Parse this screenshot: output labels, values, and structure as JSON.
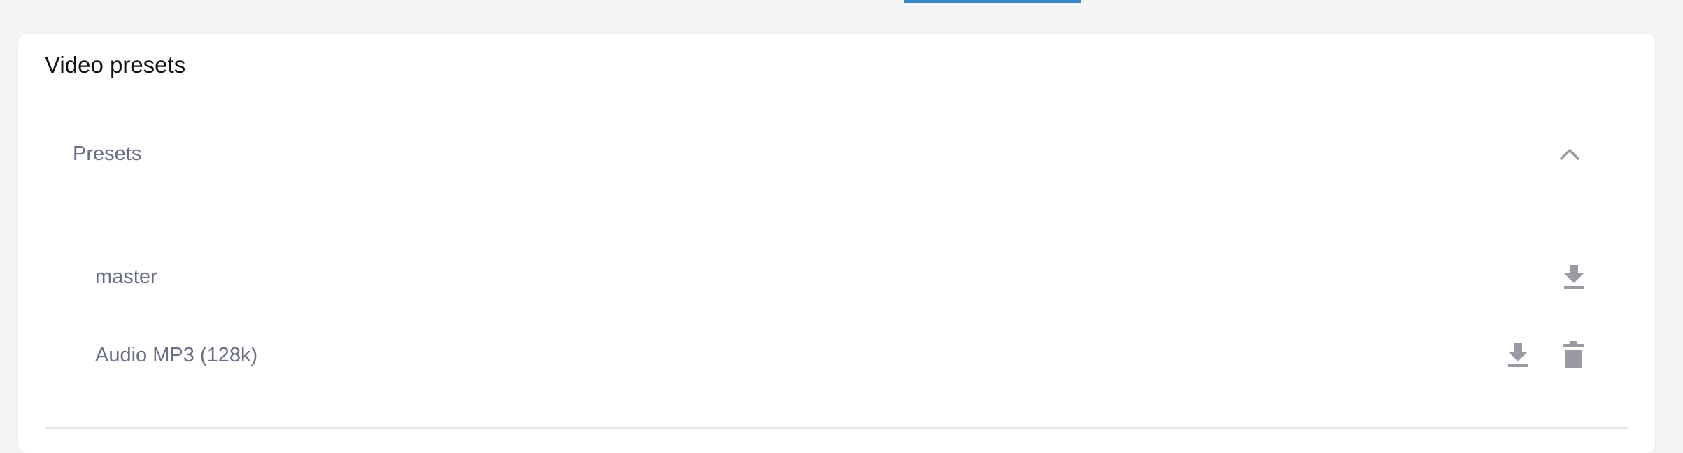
{
  "card": {
    "title": "Video presets"
  },
  "presets_section": {
    "title": "Presets",
    "expanded": true,
    "items": [
      {
        "name": "master",
        "actions": [
          "download-icon"
        ]
      },
      {
        "name": "Audio MP3 (128k)",
        "actions": [
          "download-icon",
          "trash-icon"
        ]
      }
    ]
  },
  "colors": {
    "accent": "#3b86c4",
    "icon": "#9a9aa4",
    "text_muted": "#6a6e83"
  }
}
